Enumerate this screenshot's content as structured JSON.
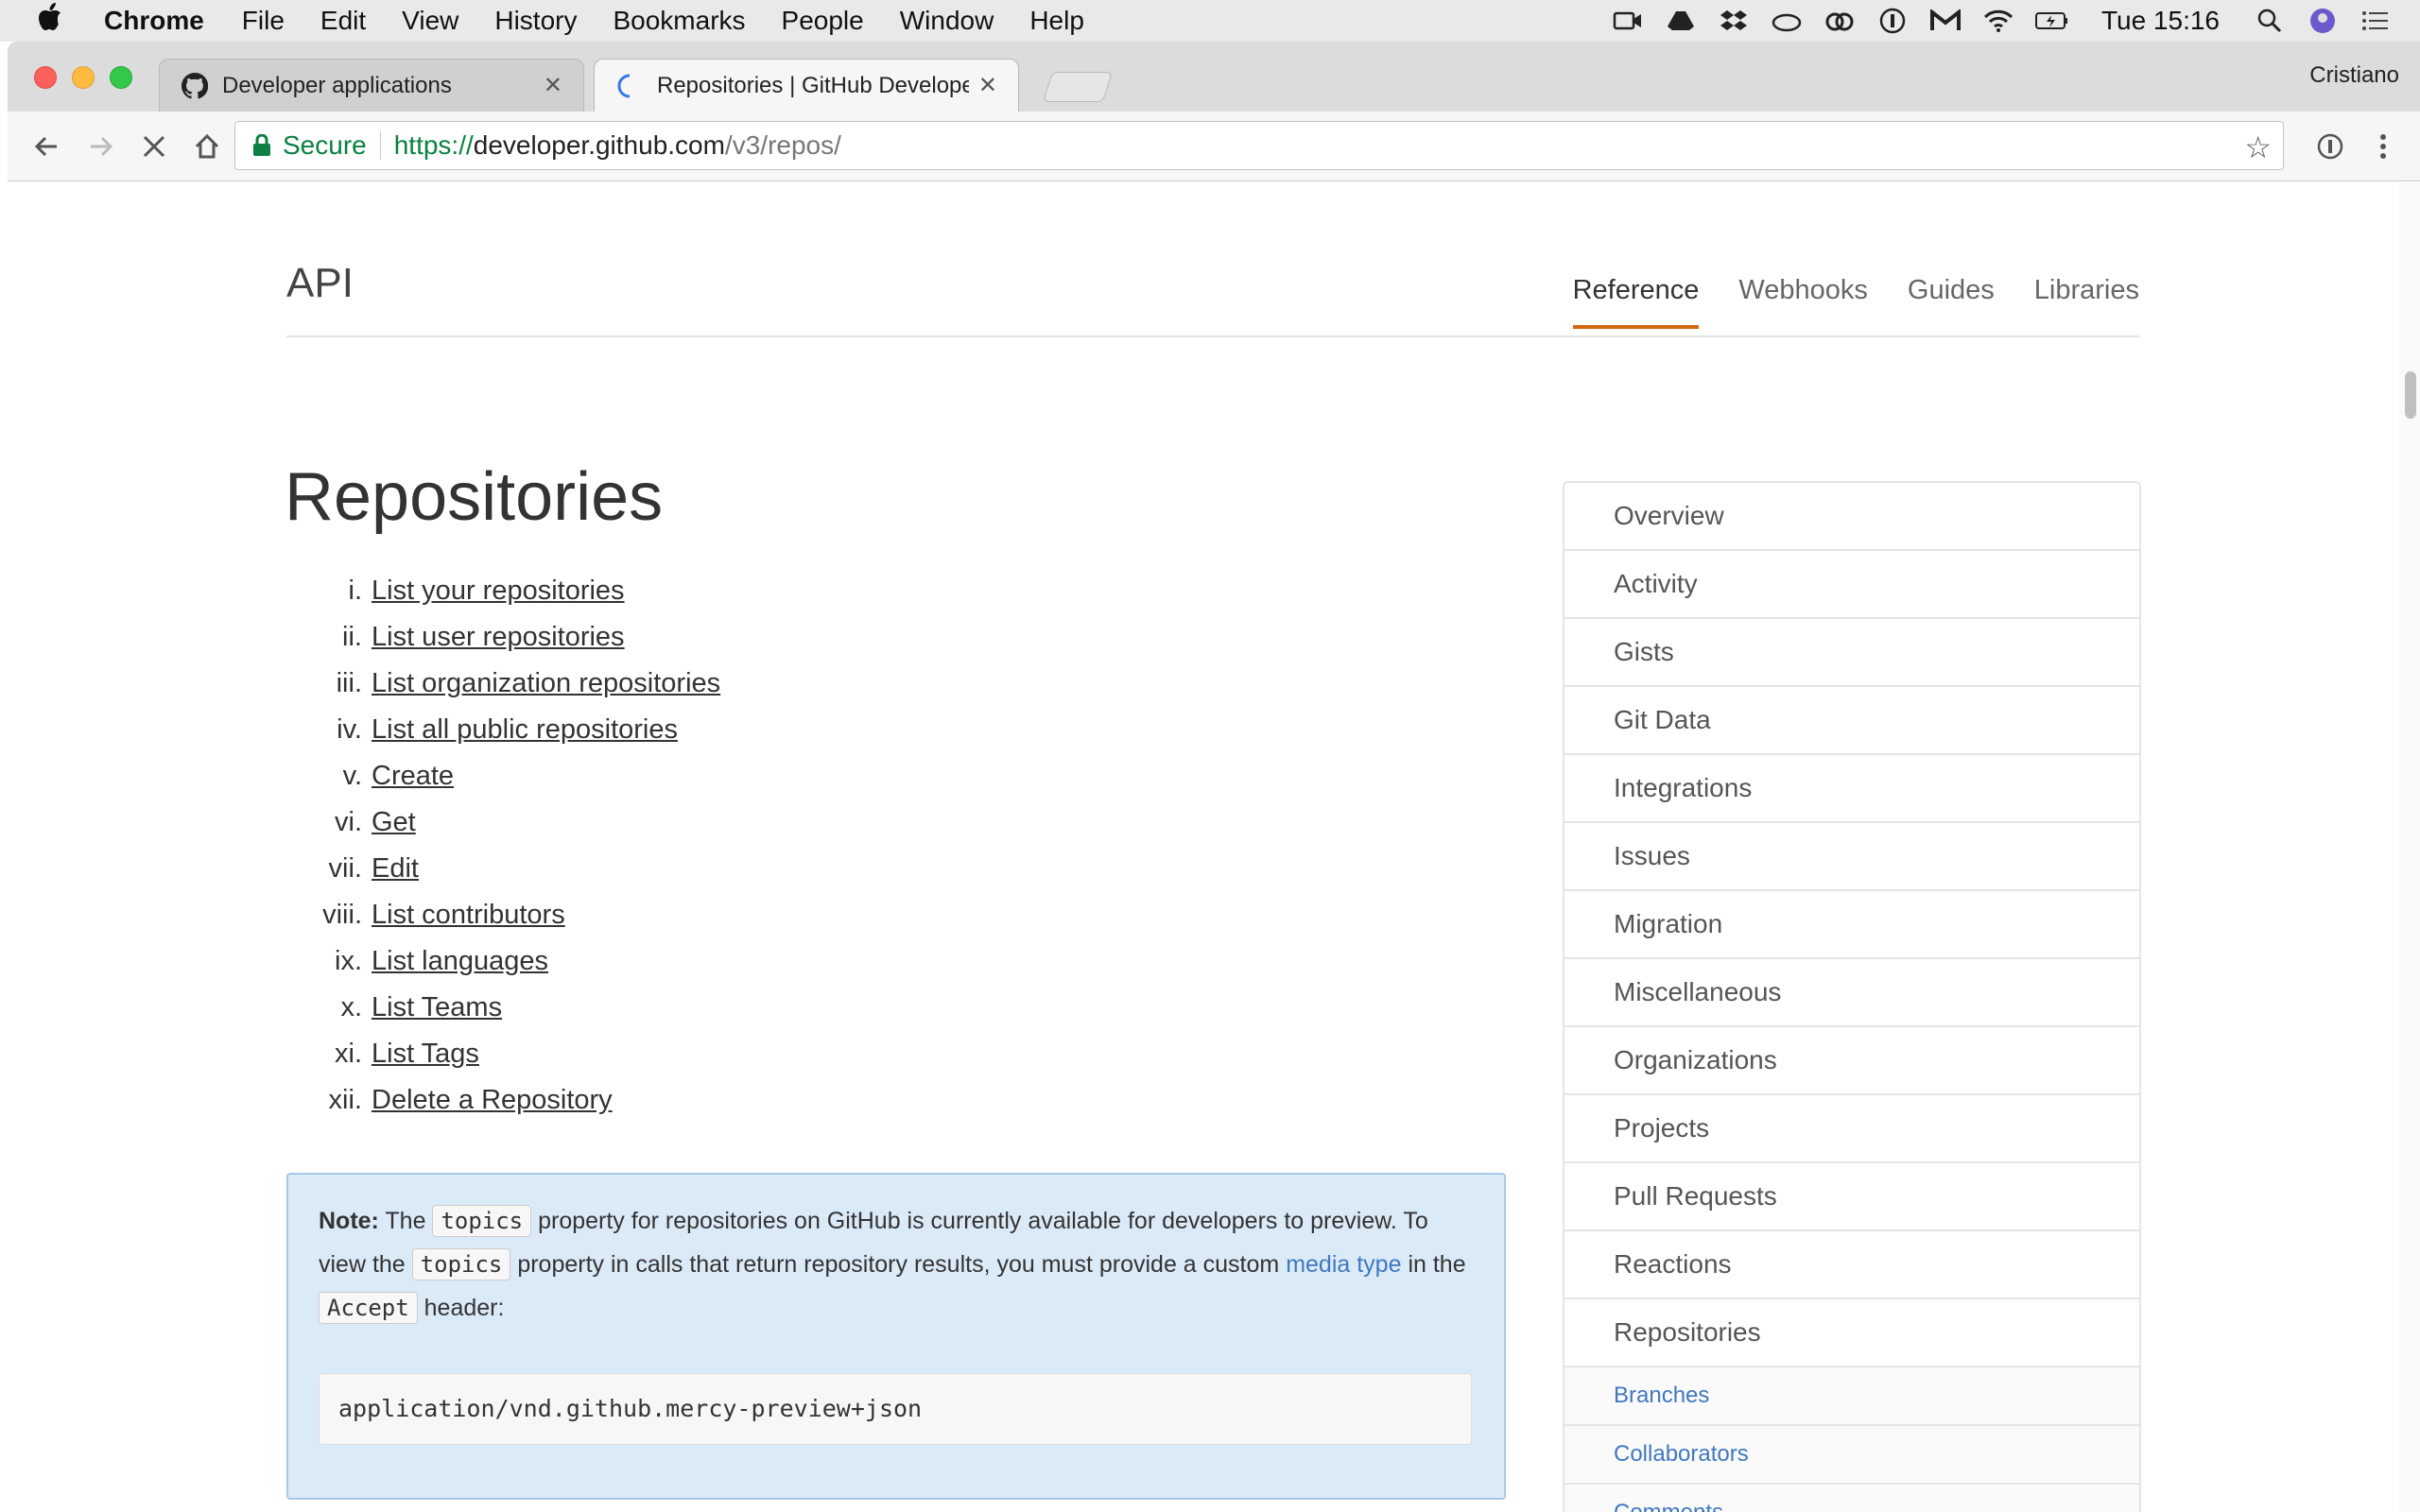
{
  "menubar": {
    "apple": "",
    "app": "Chrome",
    "items": [
      "File",
      "Edit",
      "View",
      "History",
      "Bookmarks",
      "People",
      "Window",
      "Help"
    ],
    "clock": "Tue 15:16",
    "status_icons": [
      "facetime-icon",
      "google-drive-icon",
      "dropbox-icon",
      "cloud-icon",
      "creative-cloud-icon",
      "1password-icon",
      "gmail-icon",
      "wifi-icon",
      "battery-icon",
      "spotlight-icon",
      "user-icon",
      "notification-center-icon"
    ]
  },
  "browser": {
    "tabs": [
      {
        "title": "Developer applications",
        "icon": "github-icon",
        "state": "inactive"
      },
      {
        "title": "Repositories | GitHub Developer",
        "icon": "loading-spinner-icon",
        "state": "active"
      }
    ],
    "profile": "Cristiano",
    "omnibox": {
      "secure_label": "Secure",
      "url_scheme": "https://",
      "url_host": "developer.github.com",
      "url_path": "/v3/repos/"
    }
  },
  "site": {
    "brand": "API",
    "nav": [
      "Reference",
      "Webhooks",
      "Guides",
      "Libraries"
    ],
    "nav_active": "Reference"
  },
  "main": {
    "title": "Repositories",
    "toc": [
      {
        "num": "i.",
        "label": "List your repositories"
      },
      {
        "num": "ii.",
        "label": "List user repositories"
      },
      {
        "num": "iii.",
        "label": "List organization repositories"
      },
      {
        "num": "iv.",
        "label": "List all public repositories"
      },
      {
        "num": "v.",
        "label": "Create"
      },
      {
        "num": "vi.",
        "label": "Get"
      },
      {
        "num": "vii.",
        "label": "Edit"
      },
      {
        "num": "viii.",
        "label": "List contributors"
      },
      {
        "num": "ix.",
        "label": "List languages"
      },
      {
        "num": "x.",
        "label": "List Teams"
      },
      {
        "num": "xi.",
        "label": "List Tags"
      },
      {
        "num": "xii.",
        "label": "Delete a Repository"
      }
    ],
    "note": {
      "label": "Note:",
      "t1": "The",
      "code1": "topics",
      "t2": "property for repositories on GitHub is currently available for developers to preview. To view the",
      "code2": "topics",
      "t3": "property in calls that return repository results, you must provide a custom",
      "link": "media type",
      "t4": "in the",
      "code3": "Accept",
      "t5": "header:",
      "code_block": "application/vnd.github.mercy-preview+json"
    }
  },
  "sidebar": {
    "items": [
      "Overview",
      "Activity",
      "Gists",
      "Git Data",
      "Integrations",
      "Issues",
      "Migration",
      "Miscellaneous",
      "Organizations",
      "Projects",
      "Pull Requests",
      "Reactions",
      "Repositories"
    ],
    "subitems": [
      "Branches",
      "Collaborators",
      "Comments"
    ]
  },
  "colors": {
    "nav_active_underline": "#d26911",
    "link_blue": "#4078c0",
    "note_bg": "#dbeaf7",
    "secure_green": "#0b8043"
  }
}
